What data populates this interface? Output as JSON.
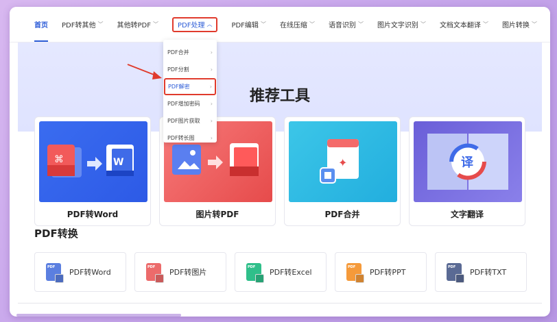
{
  "nav": {
    "items": [
      {
        "label": "首页",
        "chevron": false,
        "state": "active"
      },
      {
        "label": "PDF转其他",
        "chevron": true,
        "state": ""
      },
      {
        "label": "其他转PDF",
        "chevron": true,
        "state": ""
      },
      {
        "label": "PDF处理",
        "chevron": true,
        "state": "highlight"
      },
      {
        "label": "PDF编辑",
        "chevron": true,
        "state": ""
      },
      {
        "label": "在线压缩",
        "chevron": true,
        "state": ""
      },
      {
        "label": "语音识别",
        "chevron": true,
        "state": ""
      },
      {
        "label": "图片文字识别",
        "chevron": true,
        "state": ""
      },
      {
        "label": "文档文本翻译",
        "chevron": true,
        "state": ""
      },
      {
        "label": "图片转换",
        "chevron": true,
        "state": ""
      }
    ]
  },
  "dropdown": {
    "items": [
      "PDF合并",
      "PDF分割",
      "PDF解密",
      "PDF增加密码",
      "PDF图片获取",
      "PDF转长图"
    ],
    "selected_index": 2
  },
  "hero": {
    "title": "推荐工具"
  },
  "cards": [
    {
      "label": "PDF转Word",
      "icon": "pdf-to-word-icon"
    },
    {
      "label": "图片转PDF",
      "icon": "image-to-pdf-icon"
    },
    {
      "label": "PDF合并",
      "icon": "pdf-merge-icon"
    },
    {
      "label": "文字翻译",
      "icon": "text-translate-icon",
      "glyph": "译"
    }
  ],
  "section": {
    "title": "PDF转换"
  },
  "tools": [
    {
      "label": "PDF转Word",
      "tag": "PDF",
      "color": "#5b7fe0"
    },
    {
      "label": "PDF转图片",
      "tag": "PDF",
      "color": "#ec6b6b"
    },
    {
      "label": "PDF转Excel",
      "tag": "PDF",
      "color": "#2fbf8a"
    },
    {
      "label": "PDF转PPT",
      "tag": "PDF",
      "color": "#f59a3a"
    },
    {
      "label": "PDF转TXT",
      "tag": "PDF",
      "color": "#5a6a94"
    }
  ],
  "colors": {
    "accent": "#2b5bd7",
    "highlight_border": "#e03a2c"
  }
}
